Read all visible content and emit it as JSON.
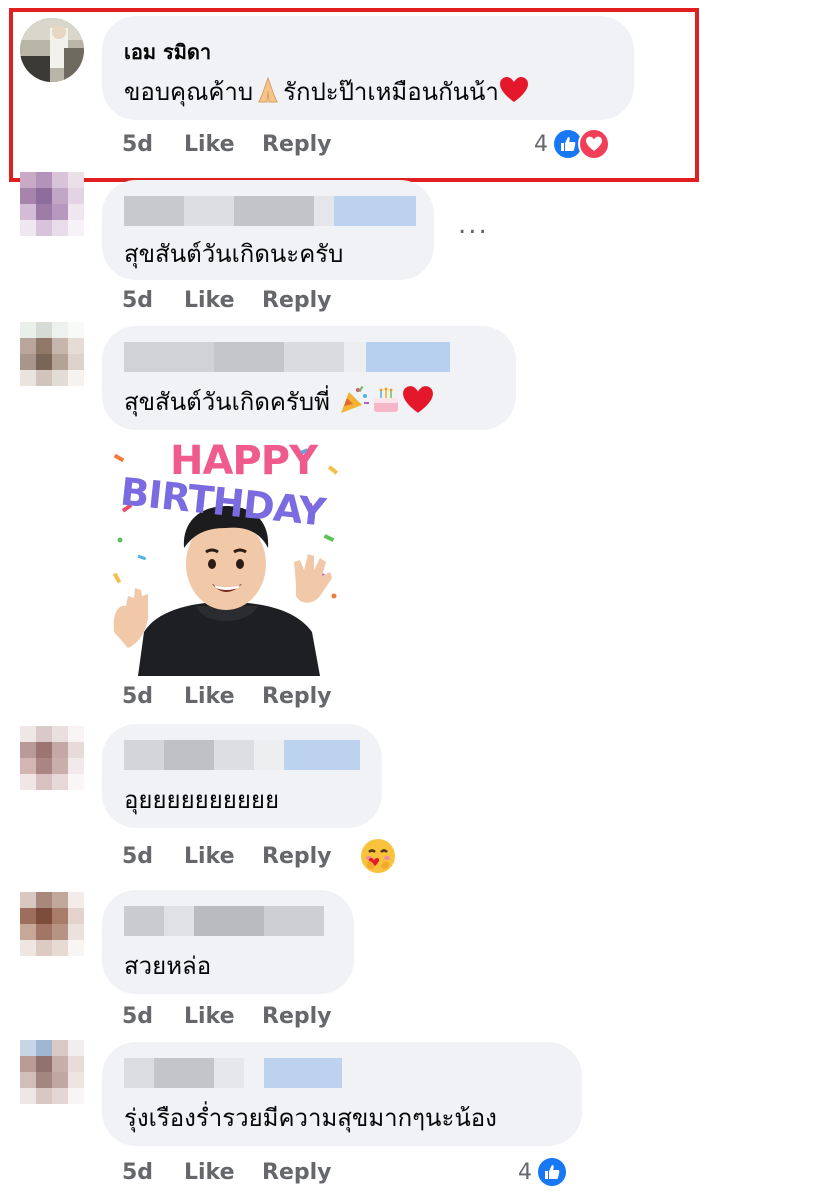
{
  "comments": [
    {
      "author": "เอม รมิดา",
      "text": "ขอบคุณค้าบ",
      "text2": "รักปะป๊าเหมือนกันน้า",
      "time": "5d",
      "like_label": "Like",
      "reply_label": "Reply",
      "reaction_count": "4"
    },
    {
      "text": "สุขสันต์วันเกิดนะครับ",
      "time": "5d",
      "like_label": "Like",
      "reply_label": "Reply",
      "more_label": "..."
    },
    {
      "text": "สุขสันต์วันเกิดครับพี่",
      "time": "5d",
      "like_label": "Like",
      "reply_label": "Reply",
      "sticker": {
        "line1": "HAPPY",
        "line2": "BIRTHDAY"
      }
    },
    {
      "text": "อุยยยยยยยยยย",
      "time": "5d",
      "like_label": "Like",
      "reply_label": "Reply"
    },
    {
      "text": "สวยหล่อ",
      "time": "5d",
      "like_label": "Like",
      "reply_label": "Reply"
    },
    {
      "text": "รุ่งเรืองร่ำรวยมีความสุขมากๆนะน้อง",
      "time": "5d",
      "like_label": "Like",
      "reply_label": "Reply",
      "reaction_count": "4"
    }
  ],
  "icons": {
    "like": "like-reaction-icon",
    "love": "love-reaction-icon",
    "pray": "folded-hands-emoji",
    "heart": "red-heart-emoji",
    "party": "party-popper-emoji",
    "cake": "birthday-cake-emoji",
    "hug": "face-holding-heart-emoji"
  },
  "colors": {
    "bubble": "#f0f2f5",
    "meta": "#65676b",
    "like_blue": "#1877f2",
    "love_red": "#f33e58",
    "highlight": "#e02020"
  }
}
